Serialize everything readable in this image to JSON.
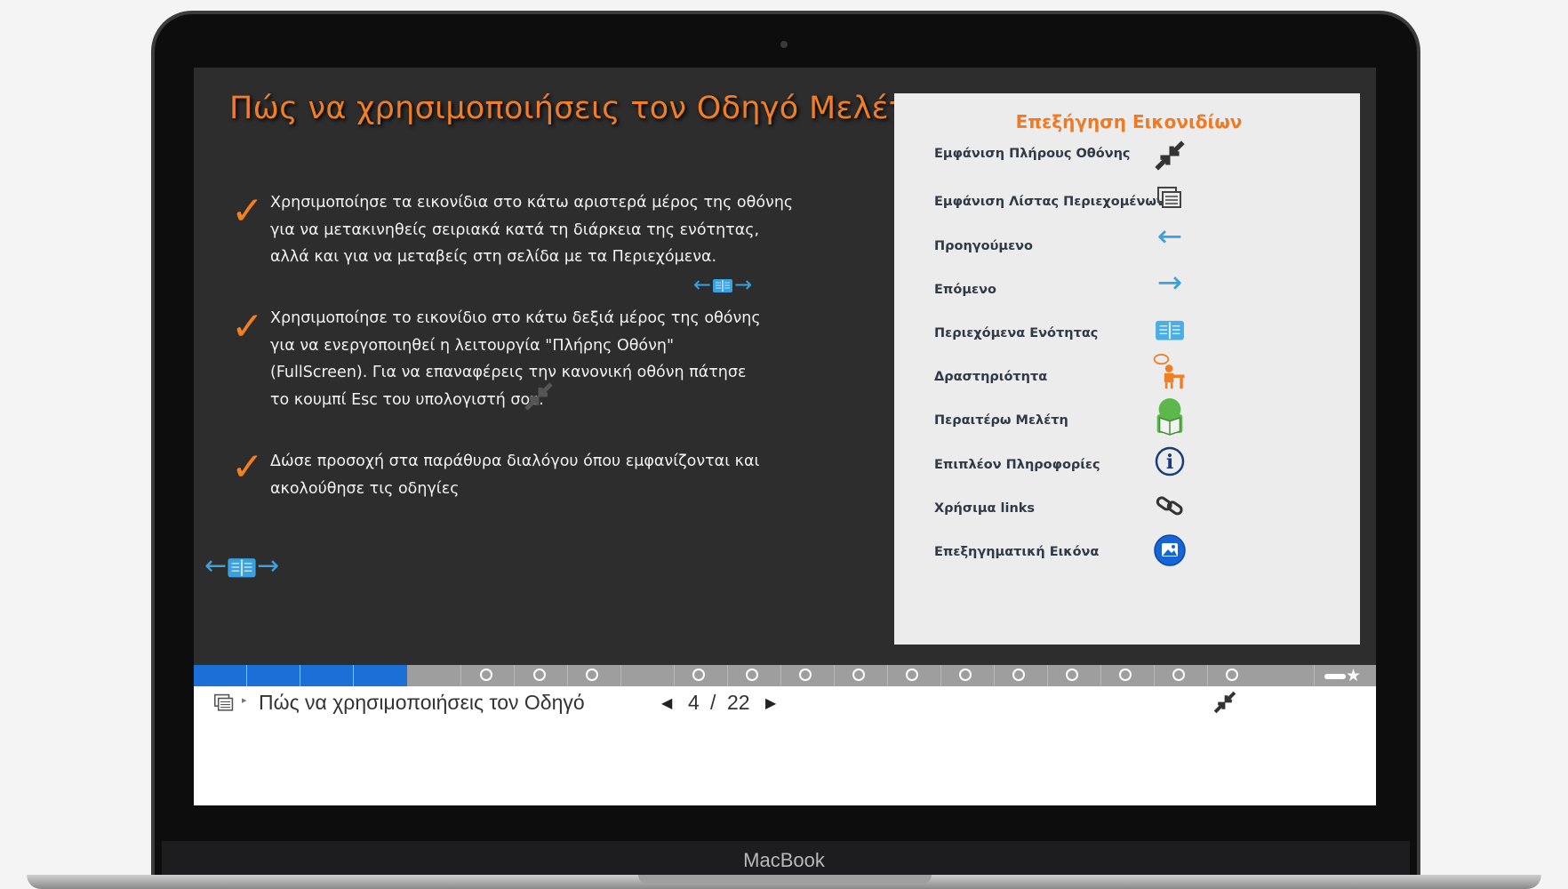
{
  "device": {
    "brand": "MacBook"
  },
  "slide": {
    "title": "Πώς να χρησιμοποιήσεις τον Οδηγό Μελέτης",
    "points": [
      {
        "lines": [
          "Χρησιμοποίησε τα εικονίδια στο κάτω αριστερά μέρος της οθόνης",
          "για να μετακινηθείς σειριακά κατά τη διάρκεια της ενότητας,",
          "αλλά και για να μεταβείς στη σελίδα με τα Περιεχόμενα."
        ]
      },
      {
        "lines": [
          "Χρησιμοποίησε το εικονίδιο στο κάτω δεξιά μέρος της οθόνης",
          "για να ενεργοποιηθεί η λειτουργία \"Πλήρης Οθόνη\"",
          "(FullScreen).  Για να επαναφέρεις την κανονική οθόνη πάτησε",
          "το κουμπί Esc του υπολογιστή σου."
        ]
      },
      {
        "lines": [
          "Δώσε προσοχή στα παράθυρα διαλόγου όπου εμφανίζονται και",
          "ακολούθησε τις οδηγίες"
        ]
      }
    ],
    "nav_icons": [
      "arrow-left-icon",
      "book-icon",
      "arrow-right-icon"
    ]
  },
  "legend": {
    "title": "Επεξήγηση Εικονιδίων",
    "items": [
      {
        "label": "Εμφάνιση Πλήρους Οθόνης",
        "icon": "fullscreen-icon"
      },
      {
        "label": "Εμφάνιση Λίστας Περιεχομένων",
        "icon": "contents-list-icon"
      },
      {
        "label": "Προηγούμενο",
        "icon": "arrow-left-icon"
      },
      {
        "label": "Επόμενο",
        "icon": "arrow-right-icon"
      },
      {
        "label": "Περιεχόμενα Ενότητας",
        "icon": "book-icon"
      },
      {
        "label": "Δραστηριότητα",
        "icon": "activity-icon"
      },
      {
        "label": "Περαιτέρω Μελέτη",
        "icon": "further-study-icon"
      },
      {
        "label": "Επιπλέον Πληροφορίες",
        "icon": "info-icon"
      },
      {
        "label": "Χρήσιμα links",
        "icon": "link-icon"
      },
      {
        "label": "Επεξηγηματική Εικόνα",
        "icon": "image-icon"
      }
    ]
  },
  "progress": {
    "current_slide": 4,
    "total_slides": 22
  },
  "toolbar": {
    "title": "Πώς να χρησιμοποιήσεις τον Οδηγό",
    "page_current": "4",
    "page_separator": "/",
    "page_total": "22"
  },
  "colors": {
    "accent_orange": "#f07e26",
    "icon_blue": "#3aa0de",
    "progress_blue": "#1d6fd8",
    "slide_bg": "#2d2d2d"
  }
}
